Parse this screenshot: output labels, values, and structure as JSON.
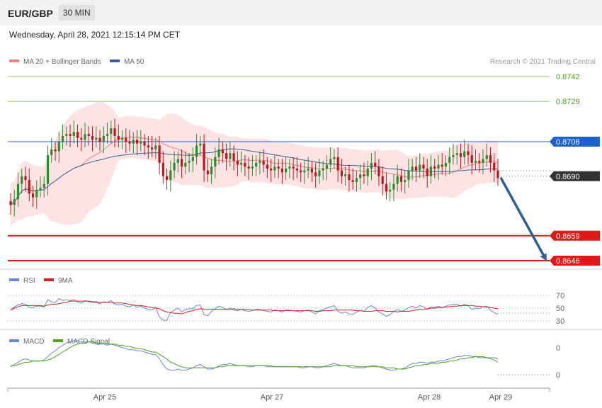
{
  "header": {
    "pair": "EUR/GBP",
    "timeframe": "30 MIN",
    "timestamp": "Wednesday, April 28, 2021 12:15:14 PM CET"
  },
  "legend": {
    "ma20": "MA 20 + Bollinger Bands",
    "ma50": "MA 50",
    "rsi": "RSI",
    "rsi_ma": "9MA",
    "macd": "MACD",
    "macd_signal": "MACD Signal",
    "credit": "Research © 2021 Trading Central"
  },
  "colors": {
    "up_candle": "#2e8b2e",
    "down_candle": "#c0161b",
    "ma20": "#f08080",
    "ma50": "#3a5f9a",
    "bollinger_fill": "#fde3e3",
    "resistance": "#8dc65a",
    "pivot": "#1e5fd0",
    "support": "#e01818",
    "rsi": "#6a86d6",
    "rsi_ma": "#d42020",
    "macd": "#6a86d6",
    "macd_signal": "#4aa31a",
    "arrow": "#2e5e96"
  },
  "chart_data": [
    {
      "type": "candlestick",
      "panel": "price",
      "x_ticks": [
        "Apr 25",
        "Apr 27",
        "Apr 28",
        "Apr 29"
      ],
      "levels": [
        {
          "value": 0.8742,
          "label": "0.8742",
          "kind": "resistance"
        },
        {
          "value": 0.8729,
          "label": "0.8729",
          "kind": "resistance"
        },
        {
          "value": 0.8708,
          "label": "0.8708",
          "kind": "pivot"
        },
        {
          "value": 0.869,
          "label": "0.8690",
          "kind": "current"
        },
        {
          "value": 0.8659,
          "label": "0.8659",
          "kind": "support"
        },
        {
          "value": 0.8646,
          "label": "0.8646",
          "kind": "support"
        }
      ],
      "last_price": 0.869,
      "forecast": {
        "from": 0.869,
        "to": 0.8646,
        "direction": "down"
      },
      "close_series": [
        0.8675,
        0.8678,
        0.8686,
        0.869,
        0.8688,
        0.8681,
        0.8679,
        0.8683,
        0.8684,
        0.8686,
        0.8701,
        0.8704,
        0.8703,
        0.8708,
        0.8711,
        0.8712,
        0.8711,
        0.8713,
        0.871,
        0.8709,
        0.8712,
        0.8711,
        0.8709,
        0.871,
        0.8708,
        0.8711,
        0.8712,
        0.8715,
        0.8711,
        0.8709,
        0.871,
        0.8708,
        0.8707,
        0.8709,
        0.8707,
        0.8708,
        0.8706,
        0.8705,
        0.8704,
        0.8706,
        0.8697,
        0.869,
        0.8688,
        0.8693,
        0.8697,
        0.8699,
        0.8695,
        0.8697,
        0.8698,
        0.87,
        0.8706,
        0.8707,
        0.8693,
        0.8691,
        0.8695,
        0.87,
        0.8704,
        0.8702,
        0.8699,
        0.8702,
        0.8698,
        0.8696,
        0.8697,
        0.8695,
        0.8694,
        0.8695,
        0.8697,
        0.8698,
        0.8696,
        0.8694,
        0.8693,
        0.8695,
        0.8694,
        0.8692,
        0.8694,
        0.8695,
        0.8694,
        0.8693,
        0.8692,
        0.8693,
        0.8694,
        0.8692,
        0.869,
        0.8693,
        0.8694,
        0.8696,
        0.8699,
        0.87,
        0.8693,
        0.869,
        0.8691,
        0.8688,
        0.8687,
        0.8689,
        0.8691,
        0.869,
        0.8694,
        0.8697,
        0.8695,
        0.869,
        0.8686,
        0.8682,
        0.8683,
        0.8686,
        0.869,
        0.8687,
        0.8688,
        0.8693,
        0.8695,
        0.8693,
        0.8696,
        0.8694,
        0.869,
        0.8695,
        0.8694,
        0.8696,
        0.8695,
        0.8697,
        0.87,
        0.8701,
        0.8702,
        0.87,
        0.8703,
        0.8701,
        0.8697,
        0.8698,
        0.8697,
        0.8699,
        0.8701,
        0.8697,
        0.8693,
        0.8689
      ]
    },
    {
      "type": "line",
      "panel": "rsi",
      "ylim": [
        30,
        70
      ],
      "y_ticks": [
        "70",
        "50",
        "30"
      ],
      "series": [
        {
          "name": "RSI",
          "values": [
            47,
            52,
            55,
            57,
            56,
            51,
            51,
            53,
            53,
            52,
            63,
            60,
            59,
            65,
            62,
            63,
            62,
            63,
            60,
            58,
            62,
            60,
            59,
            59,
            57,
            60,
            59,
            62,
            56,
            55,
            56,
            53,
            52,
            55,
            51,
            53,
            50,
            48,
            47,
            51,
            36,
            31,
            31,
            43,
            47,
            50,
            44,
            48,
            49,
            49,
            54,
            55,
            40,
            38,
            45,
            49,
            53,
            51,
            48,
            50,
            47,
            46,
            48,
            46,
            45,
            46,
            48,
            48,
            46,
            45,
            44,
            47,
            46,
            44,
            47,
            47,
            46,
            45,
            44,
            46,
            47,
            44,
            41,
            46,
            48,
            50,
            52,
            54,
            45,
            42,
            44,
            41,
            40,
            44,
            46,
            45,
            51,
            54,
            50,
            44,
            41,
            37,
            40,
            44,
            48,
            45,
            47,
            51,
            53,
            50,
            54,
            52,
            48,
            52,
            51,
            53,
            51,
            53,
            55,
            56,
            56,
            53,
            56,
            54,
            48,
            50,
            49,
            52,
            53,
            47,
            43,
            40
          ]
        },
        {
          "name": "9MA",
          "values": [
            47,
            50,
            52,
            54,
            54,
            54,
            54,
            54,
            54,
            53,
            55,
            56,
            56,
            57,
            58,
            59,
            61,
            61,
            61,
            61,
            61,
            61,
            60,
            60,
            59,
            59,
            59,
            59,
            58,
            58,
            58,
            57,
            56,
            55,
            54,
            54,
            53,
            52,
            51,
            50,
            49,
            46,
            44,
            43,
            42,
            42,
            41,
            43,
            45,
            46,
            48,
            49,
            48,
            48,
            48,
            48,
            48,
            48,
            48,
            48,
            49,
            48,
            48,
            48,
            48,
            47,
            47,
            47,
            47,
            47,
            47,
            46,
            46,
            46,
            46,
            46,
            46,
            46,
            46,
            46,
            46,
            46,
            45,
            45,
            46,
            46,
            46,
            47,
            47,
            47,
            47,
            47,
            47,
            46,
            46,
            45,
            45,
            45,
            46,
            46,
            46,
            45,
            45,
            45,
            44,
            45,
            45,
            45,
            46,
            47,
            48,
            48,
            49,
            50,
            50,
            51,
            51,
            52,
            52,
            53,
            53,
            54,
            54,
            54,
            54,
            53,
            53,
            52,
            52,
            51,
            50,
            49
          ]
        }
      ]
    },
    {
      "type": "line",
      "panel": "macd",
      "y_ticks": [
        "0",
        "0"
      ],
      "series": [
        {
          "name": "MACD",
          "values": [
            -0.3,
            -0.1,
            0.1,
            0.3,
            0.4,
            0.3,
            0.2,
            0.2,
            0.2,
            0.3,
            0.6,
            0.9,
            1.1,
            1.4,
            1.6,
            1.8,
            1.9,
            2.0,
            2.0,
            1.9,
            1.9,
            1.9,
            1.8,
            1.7,
            1.7,
            1.7,
            1.6,
            1.7,
            1.6,
            1.5,
            1.4,
            1.3,
            1.2,
            1.2,
            1.1,
            1.1,
            1.0,
            0.9,
            0.8,
            0.8,
            0.4,
            -0.1,
            -0.5,
            -0.6,
            -0.6,
            -0.5,
            -0.6,
            -0.6,
            -0.5,
            -0.4,
            -0.2,
            -0.1,
            -0.3,
            -0.5,
            -0.5,
            -0.4,
            -0.2,
            -0.1,
            -0.1,
            0.0,
            -0.1,
            -0.2,
            -0.2,
            -0.2,
            -0.3,
            -0.3,
            -0.2,
            -0.2,
            -0.2,
            -0.3,
            -0.3,
            -0.3,
            -0.3,
            -0.3,
            -0.3,
            -0.3,
            -0.3,
            -0.3,
            -0.4,
            -0.4,
            -0.3,
            -0.3,
            -0.4,
            -0.4,
            -0.3,
            -0.2,
            -0.1,
            0.0,
            -0.1,
            -0.2,
            -0.2,
            -0.3,
            -0.4,
            -0.4,
            -0.4,
            -0.4,
            -0.3,
            -0.2,
            -0.2,
            -0.3,
            -0.4,
            -0.5,
            -0.6,
            -0.6,
            -0.5,
            -0.5,
            -0.4,
            -0.2,
            0.0,
            0.0,
            0.1,
            0.1,
            0.0,
            0.1,
            0.1,
            0.2,
            0.2,
            0.3,
            0.4,
            0.5,
            0.6,
            0.6,
            0.7,
            0.7,
            0.6,
            0.6,
            0.5,
            0.5,
            0.5,
            0.4,
            0.3,
            0.1
          ]
        },
        {
          "name": "MACD Signal",
          "values": [
            -0.2,
            -0.2,
            -0.1,
            0.0,
            0.1,
            0.1,
            0.2,
            0.2,
            0.2,
            0.2,
            0.3,
            0.4,
            0.6,
            0.8,
            1.0,
            1.2,
            1.4,
            1.6,
            1.7,
            1.8,
            1.8,
            1.9,
            1.9,
            1.8,
            1.8,
            1.8,
            1.7,
            1.7,
            1.7,
            1.6,
            1.6,
            1.5,
            1.5,
            1.4,
            1.3,
            1.3,
            1.2,
            1.1,
            1.0,
            1.0,
            0.8,
            0.6,
            0.4,
            0.1,
            0.0,
            -0.2,
            -0.3,
            -0.4,
            -0.4,
            -0.4,
            -0.4,
            -0.4,
            -0.4,
            -0.4,
            -0.4,
            -0.4,
            -0.3,
            -0.3,
            -0.2,
            -0.2,
            -0.2,
            -0.2,
            -0.2,
            -0.2,
            -0.2,
            -0.2,
            -0.2,
            -0.2,
            -0.2,
            -0.2,
            -0.2,
            -0.3,
            -0.3,
            -0.3,
            -0.3,
            -0.3,
            -0.3,
            -0.3,
            -0.3,
            -0.3,
            -0.3,
            -0.3,
            -0.3,
            -0.3,
            -0.3,
            -0.3,
            -0.3,
            -0.2,
            -0.2,
            -0.2,
            -0.2,
            -0.2,
            -0.2,
            -0.3,
            -0.3,
            -0.3,
            -0.3,
            -0.3,
            -0.3,
            -0.3,
            -0.3,
            -0.4,
            -0.4,
            -0.4,
            -0.5,
            -0.5,
            -0.5,
            -0.4,
            -0.3,
            -0.2,
            -0.2,
            -0.1,
            -0.1,
            0.0,
            0.0,
            0.0,
            0.1,
            0.1,
            0.2,
            0.2,
            0.3,
            0.4,
            0.4,
            0.5,
            0.5,
            0.6,
            0.6,
            0.6,
            0.5,
            0.5,
            0.5,
            0.4
          ]
        }
      ]
    }
  ]
}
